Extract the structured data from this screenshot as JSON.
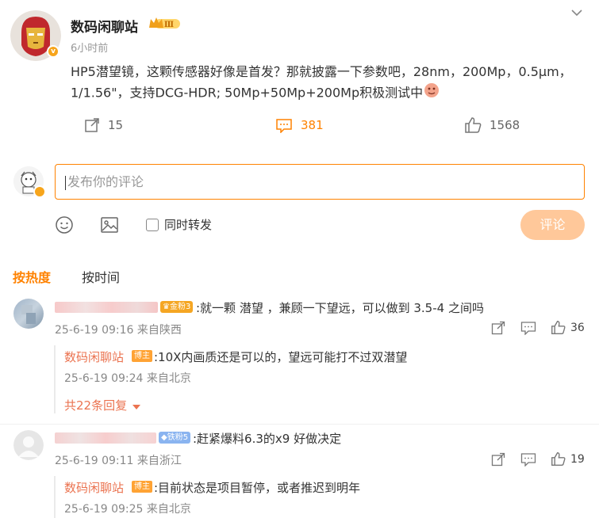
{
  "post": {
    "author": "数码闲聊站",
    "badge_level": "Ⅲ",
    "verified_mark": "v",
    "time": "6小时前",
    "text": "HP5潜望镜，这颗传感器好像是首发？那就披露一下参数吧，28nm，200Mp，0.5μm，1/1.56\"，支持DCG-HDR; 50Mp+50Mp+200Mp积极测试中",
    "emoji_icon": "emoji-face-icon",
    "actions": {
      "repost_count": "15",
      "comment_count": "381",
      "like_count": "1568"
    }
  },
  "comment_input": {
    "placeholder": "发布你的评论",
    "repost_label": "同时转发",
    "submit_label": "评论"
  },
  "sort": {
    "hot": "按热度",
    "time": "按时间"
  },
  "comments": [
    {
      "badge": "金粉3",
      "badge_color": "#f5a623",
      "text": ":就一颗 潜望 ，兼顾一下望远，可以做到 3.5-4 之间吗",
      "meta": "25-6-19 09:16 来自陕西",
      "likes": "36",
      "reply": {
        "author": "数码闲聊站",
        "tag": "博主",
        "text": ":10X内画质还是可以的，望远可能打不过双潜望",
        "meta": "25-6-19 09:24 来自北京"
      },
      "more": "共22条回复"
    },
    {
      "badge": "铁粉5",
      "badge_color": "#8ab4f0",
      "text": ":赶紧爆料6.3的x9 好做决定",
      "meta": "25-6-19 09:11 来自浙江",
      "likes": "19",
      "reply": {
        "author": "数码闲聊站",
        "tag": "博主",
        "text": ":目前状态是项目暂停，或者推迟到明年",
        "meta": "25-6-19 09:25 来自北京"
      }
    }
  ],
  "colors": {
    "accent": "#ff8200",
    "reply_author": "#eb7350",
    "submit_disabled": "#ffc89a"
  }
}
